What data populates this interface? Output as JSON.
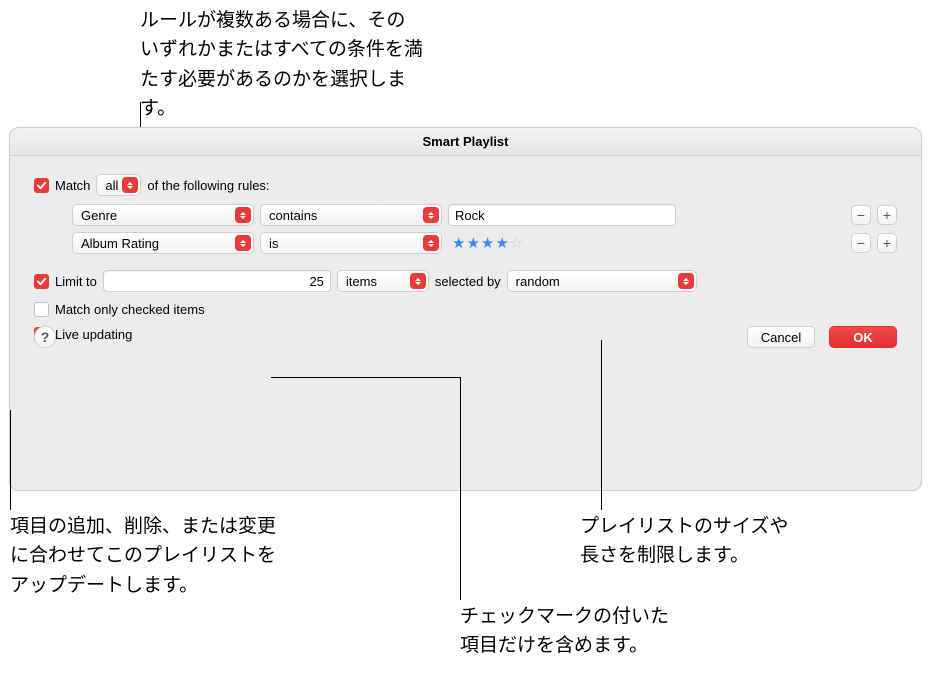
{
  "window": {
    "title": "Smart Playlist"
  },
  "match": {
    "checked": true,
    "prefix": "Match",
    "mode": "all",
    "suffix": "of the following rules:"
  },
  "rules": [
    {
      "field": "Genre",
      "op": "contains",
      "value": "Rock",
      "type": "text"
    },
    {
      "field": "Album Rating",
      "op": "is",
      "stars": 4,
      "type": "stars"
    }
  ],
  "limit": {
    "checked": true,
    "label": "Limit to",
    "count": "25",
    "unit": "items",
    "selectedByLabel": "selected by",
    "selectedBy": "random"
  },
  "matchChecked": {
    "checked": false,
    "label": "Match only checked items"
  },
  "liveUpdate": {
    "checked": true,
    "label": "Live updating"
  },
  "buttons": {
    "help": "?",
    "cancel": "Cancel",
    "ok": "OK"
  },
  "callouts": {
    "top": "ルールが複数ある場合に、その\nいずれかまたはすべての条件を満\nたす必要があるのかを選択します。",
    "live": "項目の追加、削除、または変更\nに合わせてこのプレイリストを\nアップデートします。",
    "size": "プレイリストのサイズや\n長さを制限します。",
    "checkedOnly": "チェックマークの付いた\n項目だけを含めます。"
  },
  "icons": {
    "minus": "−",
    "plus": "+"
  }
}
